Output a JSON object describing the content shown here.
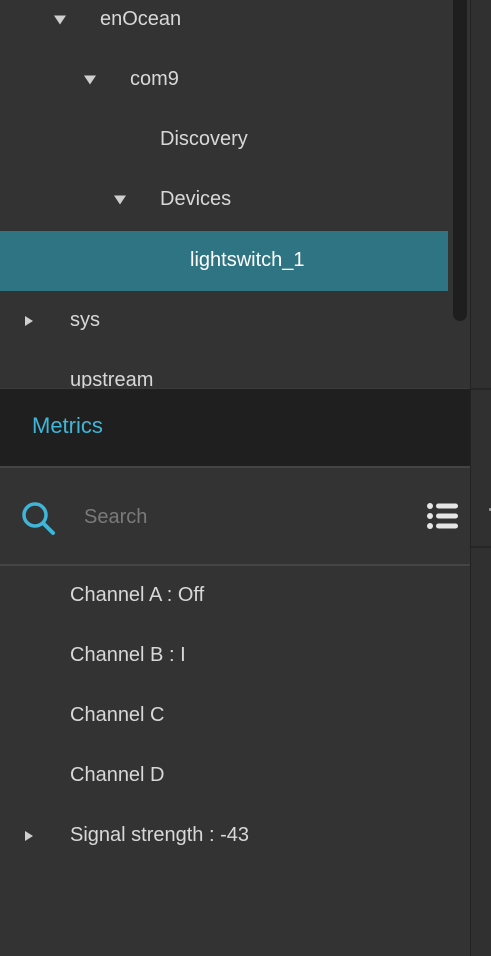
{
  "tree": {
    "items": [
      {
        "label": "enOcean",
        "state": "expanded"
      },
      {
        "label": "com9",
        "state": "expanded"
      },
      {
        "label": "Discovery",
        "state": "leaf"
      },
      {
        "label": "Devices",
        "state": "expanded"
      },
      {
        "label": "lightswitch_1",
        "state": "leaf",
        "selected": true
      },
      {
        "label": "sys",
        "state": "collapsed"
      },
      {
        "label": "upstream",
        "state": "leaf"
      }
    ]
  },
  "tabs": {
    "metrics_label": "Metrics"
  },
  "search": {
    "placeholder": "Search",
    "value": ""
  },
  "metrics": {
    "items": [
      {
        "label": "Channel A : Off"
      },
      {
        "label": "Channel B : I"
      },
      {
        "label": "Channel C"
      },
      {
        "label": "Channel D"
      },
      {
        "label": "Signal strength : -43",
        "expandable": true
      }
    ]
  },
  "colors": {
    "accent": "#3fb6d8",
    "selection": "#2e7482",
    "background": "#333333",
    "tab_background": "#1f1f1f"
  },
  "icons": {
    "search": "search-icon",
    "list_options": "list-icon",
    "expanded": "triangle-down-icon",
    "collapsed": "triangle-right-icon"
  }
}
